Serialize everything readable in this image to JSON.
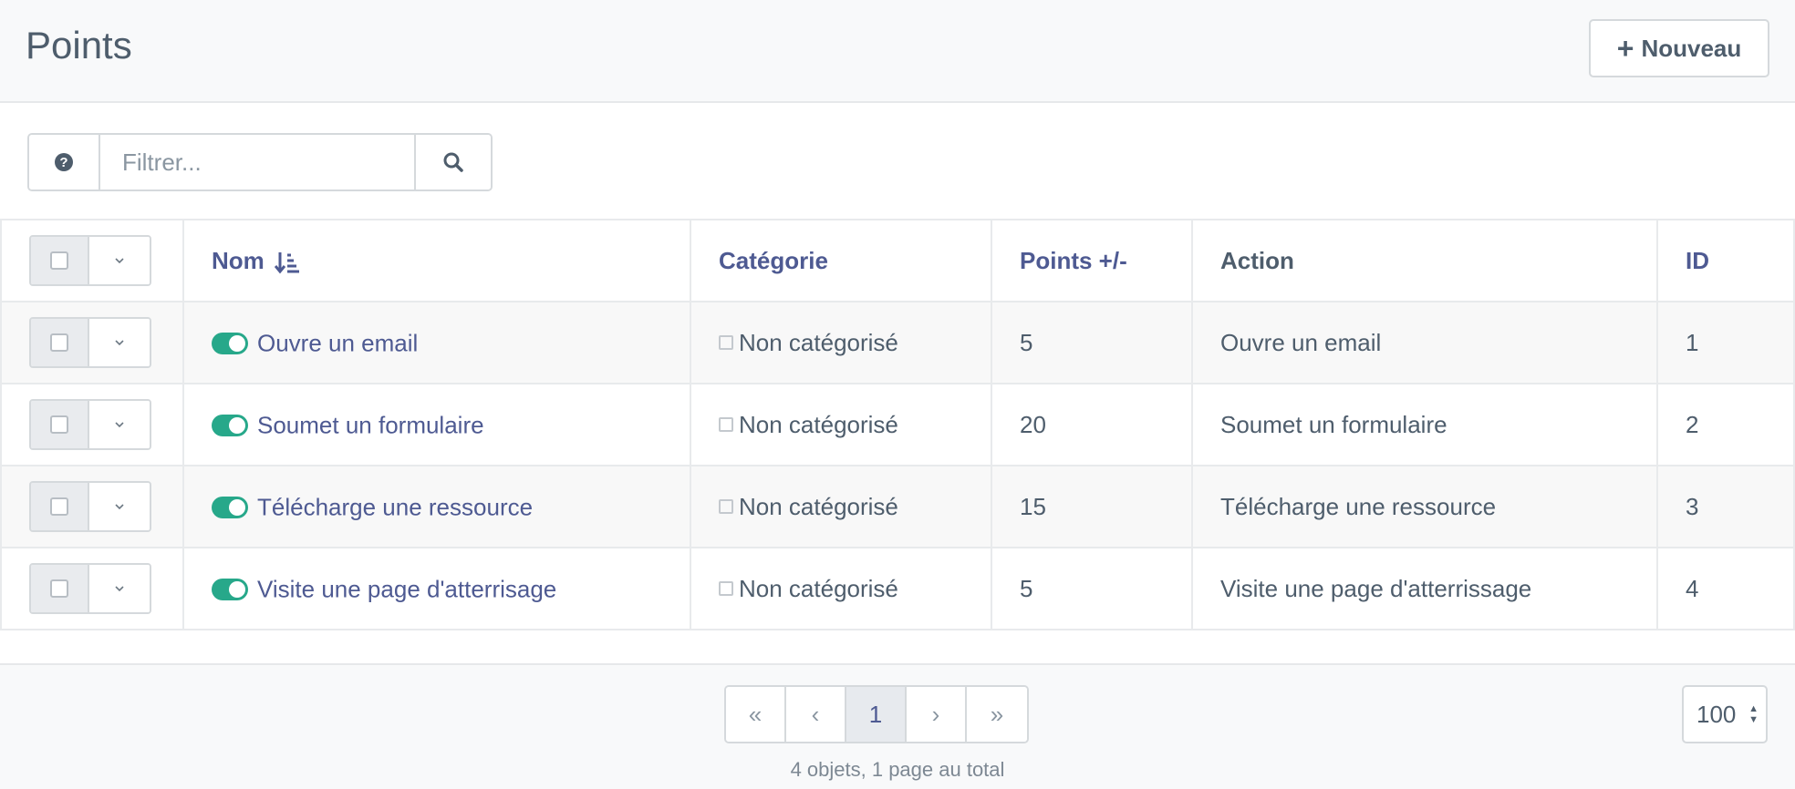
{
  "header": {
    "title": "Points",
    "new_button_label": "Nouveau"
  },
  "filter": {
    "placeholder": "Filtrer...",
    "value": ""
  },
  "table": {
    "columns": {
      "name": "Nom",
      "category": "Catégorie",
      "points": "Points +/-",
      "action": "Action",
      "id": "ID"
    },
    "rows": [
      {
        "name": "Ouvre un email",
        "published": true,
        "category": "Non catégorisé",
        "points": "5",
        "action": "Ouvre un email",
        "id": "1"
      },
      {
        "name": "Soumet un formulaire",
        "published": true,
        "category": "Non catégorisé",
        "points": "20",
        "action": "Soumet un formulaire",
        "id": "2"
      },
      {
        "name": "Télécharge une ressource",
        "published": true,
        "category": "Non catégorisé",
        "points": "15",
        "action": "Télécharge une ressource",
        "id": "3"
      },
      {
        "name": "Visite une page d'atterrisage",
        "published": true,
        "category": "Non catégorisé",
        "points": "5",
        "action": "Visite une page d'atterrissage",
        "id": "4"
      }
    ]
  },
  "pagination": {
    "first": "«",
    "prev": "‹",
    "current_page": "1",
    "next": "›",
    "last": "»",
    "summary": "4 objets, 1 page au total",
    "per_page": "100"
  },
  "colors": {
    "link": "#4e5a92",
    "toggle_on": "#27a88a",
    "text": "#4e5d6c"
  },
  "icons": {
    "new": "plus-icon",
    "help": "question-circle-icon",
    "search": "search-icon",
    "sort": "sort-amount-down-icon",
    "row_menu": "chevron-down-icon",
    "published": "toggle-on-icon"
  }
}
